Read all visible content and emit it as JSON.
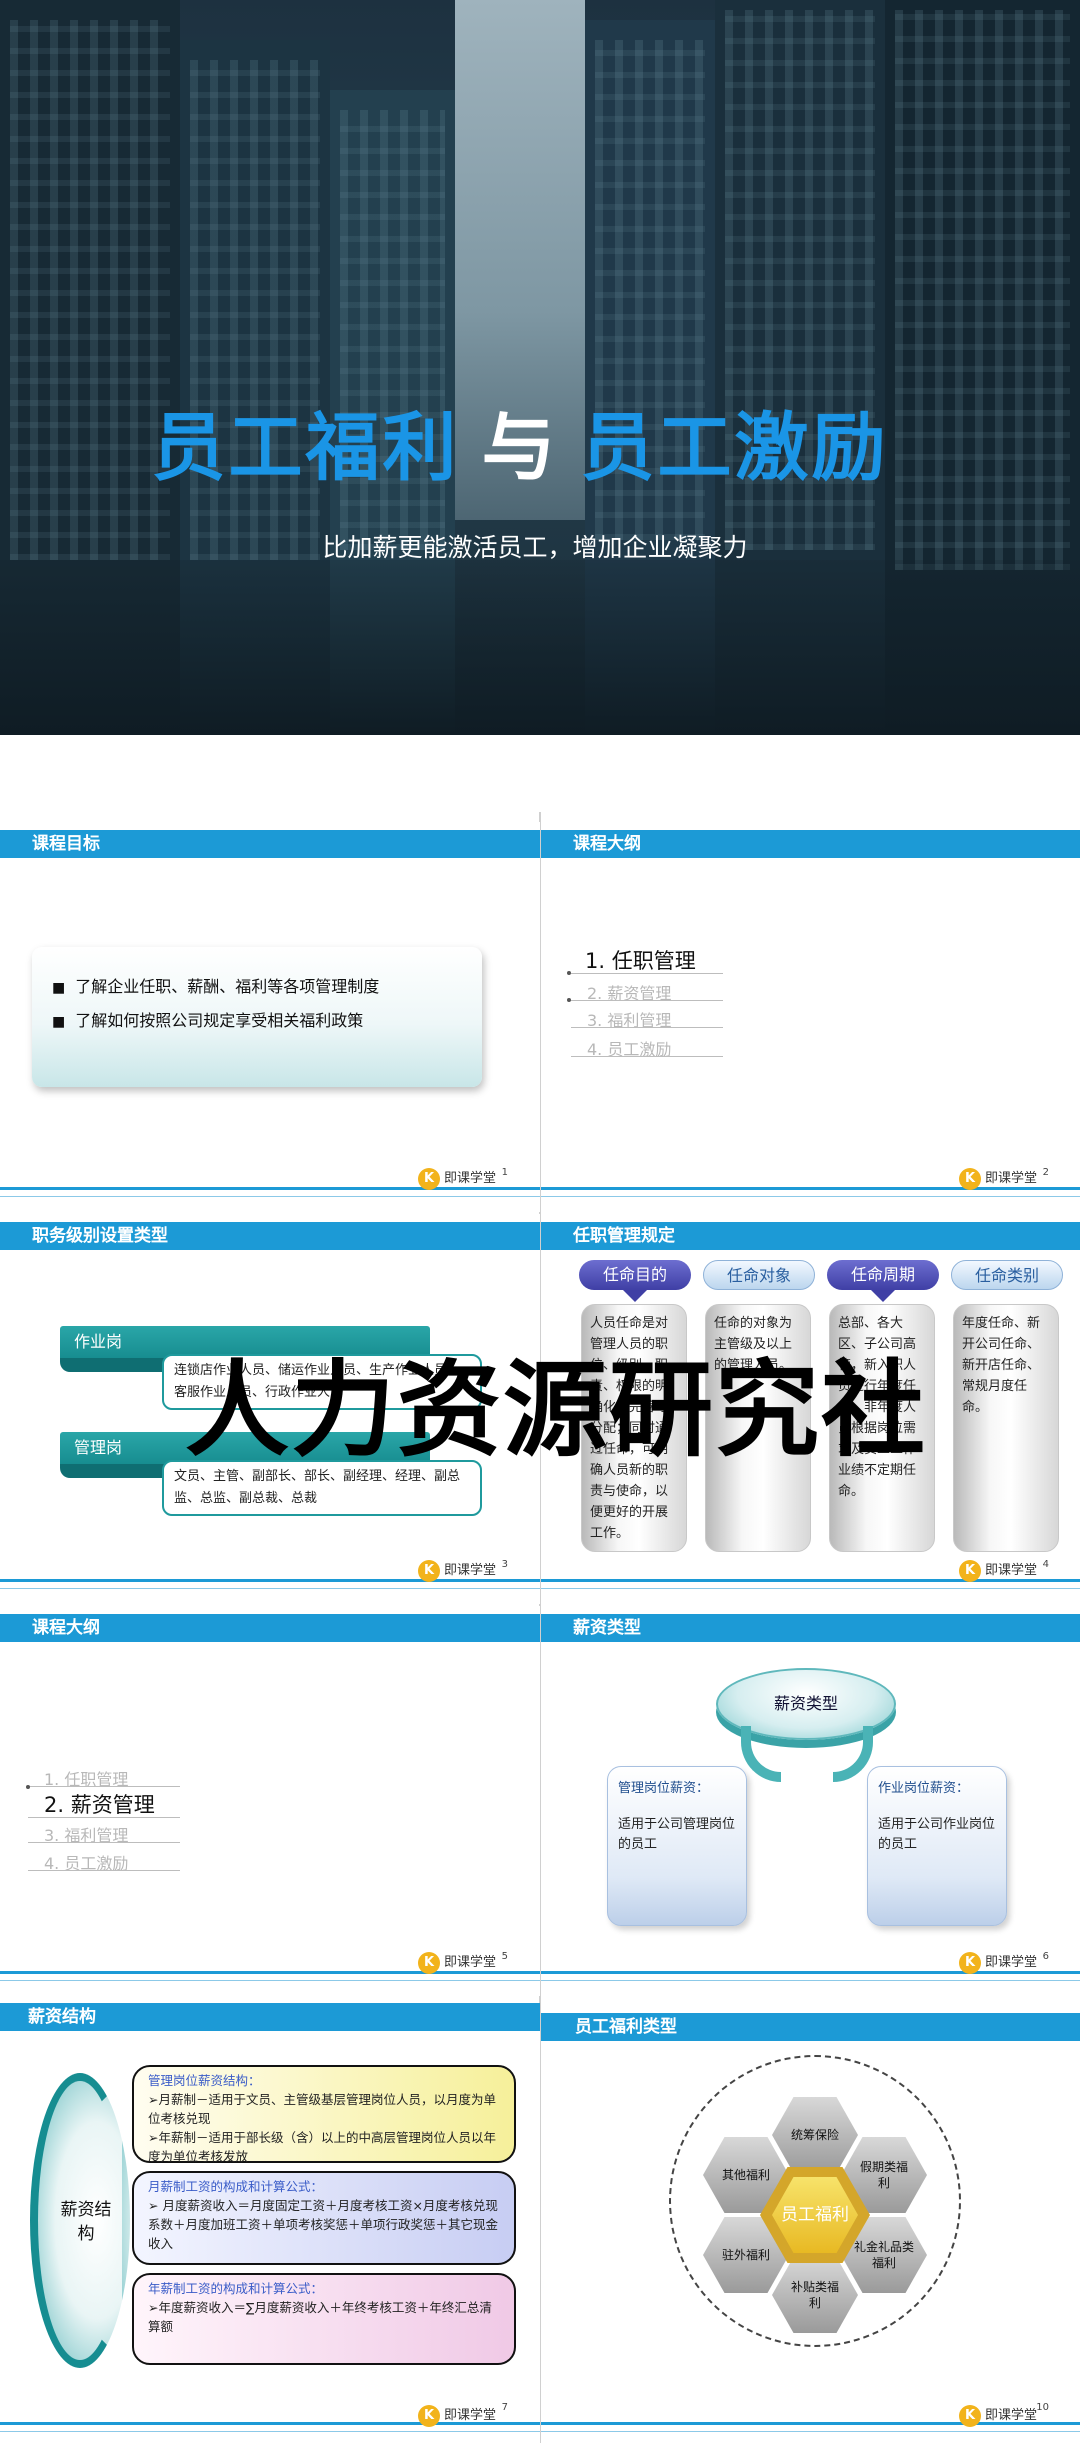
{
  "cover": {
    "title_part1": "员工福利",
    "title_joiner": "与",
    "title_part2": "员工激励",
    "subtitle": "比加薪更能激活员工，增加企业凝聚力"
  },
  "logo": {
    "mark": "K",
    "text": "即课学堂"
  },
  "watermark": "人力资源研究社",
  "slides": [
    {
      "page": "1",
      "title": "课程目标",
      "items": [
        "了解企业任职、薪酬、福利等各项管理制度",
        "了解如何按照公司规定享受相关福利政策"
      ]
    },
    {
      "page": "2",
      "title": "课程大纲",
      "outline": [
        "1. 任职管理",
        "2. 薪资管理",
        "3. 福利管理",
        "4. 员工激励"
      ],
      "active_index": 0
    },
    {
      "page": "3",
      "title": "职务级别设置类型",
      "groups": [
        {
          "tag": "作业岗",
          "desc": "连锁店作业人员、储运作业人员、生产作业人员、客服作业人员、行政作业人员"
        },
        {
          "tag": "管理岗",
          "desc": "文员、主管、副部长、部长、副经理、经理、副总监、总监、副总裁、总裁"
        }
      ]
    },
    {
      "page": "4",
      "title": "任职管理规定",
      "pills": [
        "任命目的",
        "任命对象",
        "任命周期",
        "任命类别"
      ],
      "columns": [
        "人员任命是对管理人员的职位、级别、职责、权限的明确化、完善与分配；同时通过任命，可明确人员新的职责与使命，以便更好的开展工作。",
        "任命的对象为主管级及以上的管理人员。",
        "总部、各大区、子公司高管，新入职人员进行年度任命，非年度人员根据岗位需求及员工工作业绩不定期任命。",
        "年度任命、新开公司任命、新开店任命、常规月度任命。"
      ]
    },
    {
      "page": "5",
      "title": "课程大纲",
      "outline": [
        "1. 任职管理",
        "2. 薪资管理",
        "3. 福利管理",
        "4. 员工激励"
      ],
      "active_index": 1
    },
    {
      "page": "6",
      "title": "薪资类型",
      "center": "薪资类型",
      "cards": [
        {
          "head": "管理岗位薪资：",
          "body": "适用于公司管理岗位的员工"
        },
        {
          "head": "作业岗位薪资：",
          "body": "适用于公司作业岗位的员工"
        }
      ]
    },
    {
      "page": "7",
      "title": "薪资结构",
      "oval": "薪资结构",
      "boxes": [
        {
          "head": "管理岗位薪资结构：",
          "lines": [
            "➢月薪制－适用于文员、主管级基层管理岗位人员，以月度为单位考核兑现",
            "➢年薪制－适用于部长级（含）以上的中高层管理岗位人员以年度为单位考核发放"
          ]
        },
        {
          "head": "月薪制工资的构成和计算公式：",
          "lines": [
            "➢ 月度薪资收入＝月度固定工资＋月度考核工资×月度考核兑现系数＋月度加班工资＋单项考核奖惩＋单项行政奖惩＋其它现金收入"
          ]
        },
        {
          "head": "年薪制工资的构成和计算公式：",
          "lines": [
            "➢年度薪资收入＝∑月度薪资收入＋年终考核工资＋年终汇总清算额"
          ]
        }
      ]
    },
    {
      "page": "10",
      "title": "员工福利类型",
      "center": "员工福利",
      "hexes": [
        "统筹保险",
        "假期类福利",
        "礼金礼品类福利",
        "补贴类福利",
        "驻外福利",
        "其他福利"
      ]
    }
  ]
}
